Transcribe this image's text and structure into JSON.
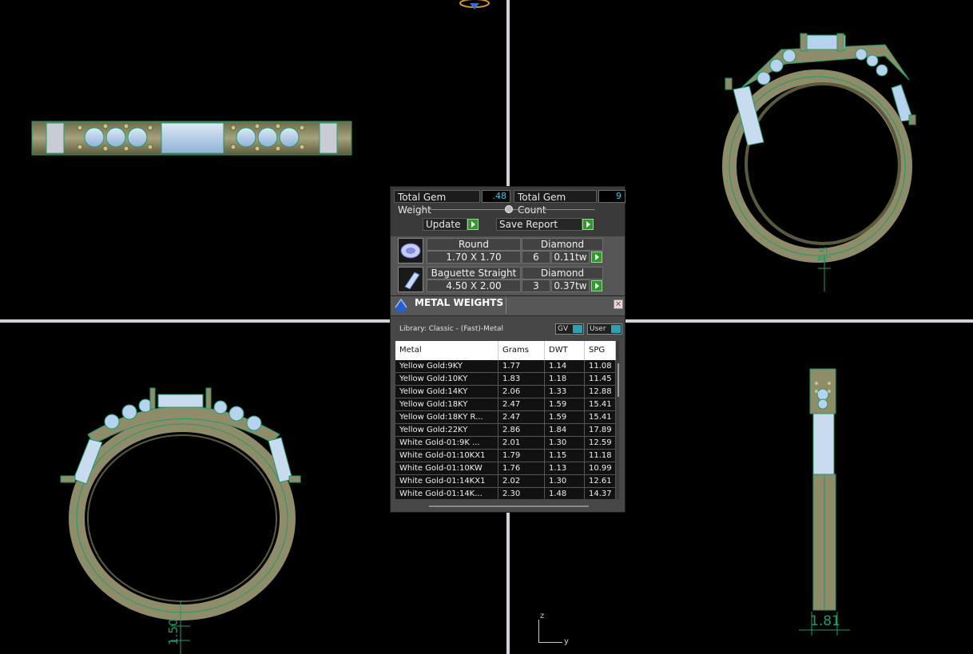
{
  "gem_panel": {
    "total_gem_weight_label": "Total Gem Weight",
    "total_gem_weight_value": ".48",
    "total_gem_count_label": "Total Gem Count",
    "total_gem_count_value": "9",
    "update_label": "Update",
    "save_report_label": "Save Report",
    "gems": [
      {
        "shape": "Round",
        "material": "Diamond",
        "size": "1.70 X 1.70",
        "count": "6",
        "weight": "0.11tw",
        "icon": "round-gem-icon"
      },
      {
        "shape": "Baguette Straight",
        "material": "Diamond",
        "size": "4.50 X 2.00",
        "count": "3",
        "weight": "0.37tw",
        "icon": "baguette-gem-icon"
      }
    ]
  },
  "metal_weights": {
    "title": "METAL WEIGHTS",
    "library": "Library: Classic - (Fast)-Metal",
    "toggle_gv": "GV",
    "toggle_user": "User",
    "columns": [
      "Metal",
      "Grams",
      "DWT",
      "SPG"
    ],
    "rows": [
      [
        "Yellow Gold:9KY",
        "1.77",
        "1.14",
        "11.08"
      ],
      [
        "Yellow Gold:10KY",
        "1.83",
        "1.18",
        "11.45"
      ],
      [
        "Yellow Gold:14KY",
        "2.06",
        "1.33",
        "12.88"
      ],
      [
        "Yellow Gold:18KY",
        "2.47",
        "1.59",
        "15.41"
      ],
      [
        "Yellow Gold:18KY R...",
        "2.47",
        "1.59",
        "15.41"
      ],
      [
        "Yellow Gold:22KY",
        "2.86",
        "1.84",
        "17.89"
      ],
      [
        "White Gold-01:9K ...",
        "2.01",
        "1.30",
        "12.59"
      ],
      [
        "White Gold-01:10KX1",
        "1.79",
        "1.15",
        "11.18"
      ],
      [
        "White Gold-01:10KW",
        "1.76",
        "1.13",
        "10.99"
      ],
      [
        "White Gold-01:14KX1",
        "2.02",
        "1.30",
        "12.61"
      ],
      [
        "White Gold-01:14K...",
        "2.30",
        "1.48",
        "14.37"
      ]
    ]
  },
  "dimensions": {
    "front_view": "1.50",
    "side_view": "1.81",
    "perspective_view": "1.5"
  },
  "axes": {
    "z": "z",
    "y": "y"
  },
  "colors": {
    "metal": "#8f8c6a",
    "metal_dark": "#5b5a3c",
    "gem": "#b6d2ee",
    "edge": "#1e9a6a",
    "divider": "#cfd2d6"
  }
}
